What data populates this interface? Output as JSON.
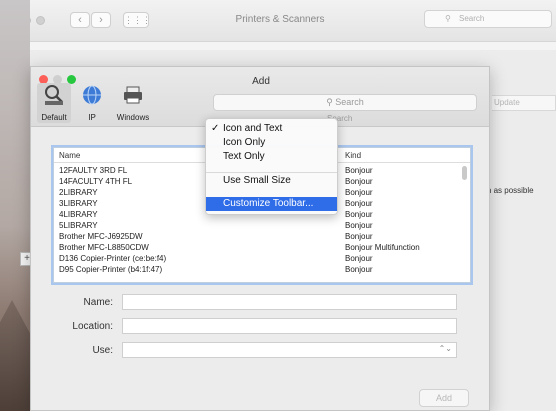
{
  "bg_window": {
    "title": "Printers & Scanners",
    "search_placeholder": "Search",
    "update_label": "Update",
    "soon_text": "soon as possible",
    "plus_label": "+"
  },
  "add_window": {
    "title": "Add",
    "search_placeholder": "Search",
    "search_label": "Search",
    "toolbar": {
      "default_label": "Default",
      "ip_label": "IP",
      "windows_label": "Windows"
    },
    "list": {
      "col_name": "Name",
      "col_kind": "Kind",
      "rows": [
        {
          "name": "12FAULTY 3RD FL",
          "kind": "Bonjour"
        },
        {
          "name": "14FACULTY 4TH FL",
          "kind": "Bonjour"
        },
        {
          "name": "2LIBRARY",
          "kind": "Bonjour"
        },
        {
          "name": "3LIBRARY",
          "kind": "Bonjour"
        },
        {
          "name": "4LIBRARY",
          "kind": "Bonjour"
        },
        {
          "name": "5LIBRARY",
          "kind": "Bonjour"
        },
        {
          "name": "Brother MFC-J6925DW",
          "kind": "Bonjour"
        },
        {
          "name": "Brother MFC-L8850CDW",
          "kind": "Bonjour Multifunction"
        },
        {
          "name": "D136 Copier-Printer (ce:be:f4)",
          "kind": "Bonjour"
        },
        {
          "name": "D95 Copier-Printer (b4:1f:47)",
          "kind": "Bonjour"
        }
      ]
    },
    "form": {
      "name_label": "Name:",
      "location_label": "Location:",
      "use_label": "Use:",
      "name_value": "",
      "location_value": "",
      "use_value": ""
    },
    "add_button": "Add"
  },
  "context_menu": {
    "check": "✓",
    "items": {
      "icon_and_text": "Icon and Text",
      "icon_only": "Icon Only",
      "text_only": "Text Only",
      "use_small_size": "Use Small Size",
      "customize_toolbar": "Customize Toolbar..."
    },
    "selected": "Icon and Text"
  },
  "colors": {
    "menu_highlight": "#2f6ce8",
    "list_focus_ring": "#a9c6ef",
    "traffic_red": "#fc5f57",
    "traffic_yellow": "#fdbc2e",
    "traffic_green": "#27c840"
  }
}
